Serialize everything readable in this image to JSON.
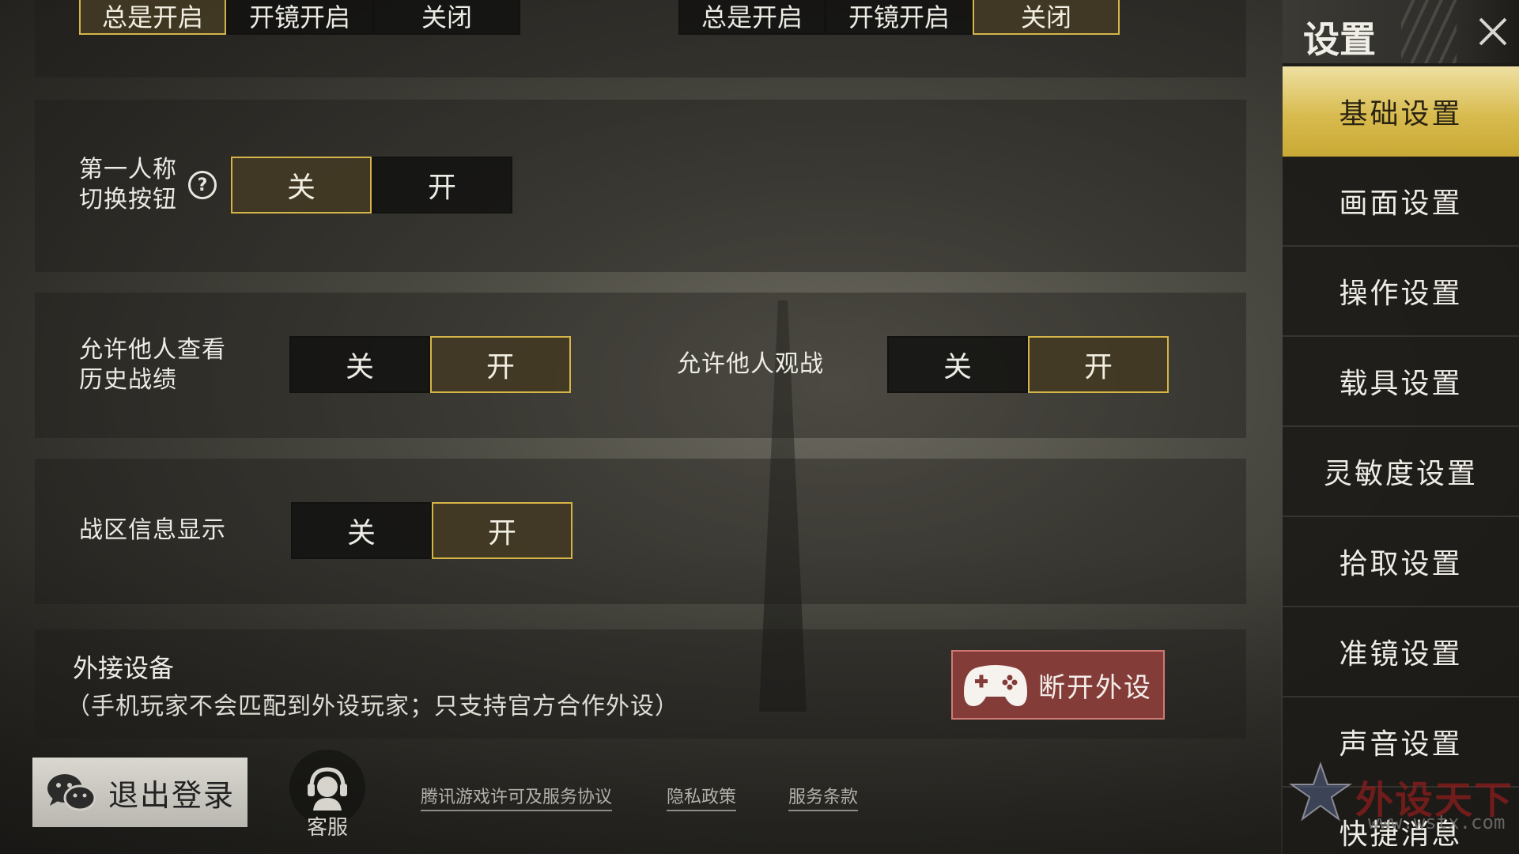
{
  "top_row": {
    "left_options": [
      "总是开启",
      "开镜开启",
      "关闭"
    ],
    "left_selected": 0,
    "right_options": [
      "总是开启",
      "开镜开启",
      "关闭"
    ],
    "right_selected": 2
  },
  "first_person": {
    "label_line1": "第一人称",
    "label_line2": "切换按钮",
    "help_glyph": "?",
    "off": "关",
    "on": "开",
    "value": "关"
  },
  "history": {
    "label_line1": "允许他人查看",
    "label_line2": "历史战绩",
    "off": "关",
    "on": "开",
    "value": "开"
  },
  "spectate": {
    "label": "允许他人观战",
    "off": "关",
    "on": "开",
    "value": "开"
  },
  "zone_info": {
    "label": "战区信息显示",
    "off": "关",
    "on": "开",
    "value": "开"
  },
  "external": {
    "title": "外接设备",
    "subtitle": "（手机玩家不会匹配到外设玩家；只支持官方合作外设）",
    "disconnect_label": "断开外设",
    "disconnect_icon": "gamepad-icon"
  },
  "bottom": {
    "logout_label": "退出登录",
    "logout_icon": "wechat-icon",
    "cs_label": "客服",
    "cs_icon": "headset-icon",
    "links": [
      "腾讯游戏许可及服务协议",
      "隐私政策",
      "服务条款"
    ]
  },
  "sidebar": {
    "title": "设置",
    "close_icon": "close-icon",
    "items": [
      "基础设置",
      "画面设置",
      "操作设置",
      "载具设置",
      "灵敏度设置",
      "拾取设置",
      "准镜设置",
      "声音设置",
      "快捷消息"
    ],
    "active_index": 0
  },
  "watermark": {
    "text": "外设天下",
    "url": "www.wstx.com"
  },
  "colors": {
    "accent_gold": "#d6b548",
    "selected_bg": "#423a24",
    "disconnect_red": "#843c38",
    "sidebar_active": "#d8bb4f"
  }
}
